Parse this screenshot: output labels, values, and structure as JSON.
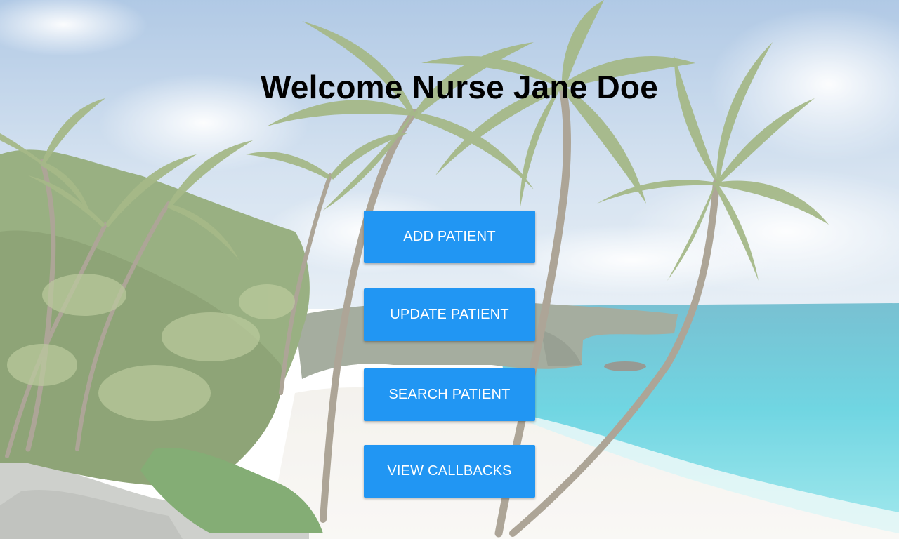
{
  "header": {
    "title": "Welcome Nurse Jane Doe"
  },
  "menu": {
    "buttons": [
      {
        "label": "ADD PATIENT"
      },
      {
        "label": "UPDATE PATIENT"
      },
      {
        "label": "SEARCH PATIENT"
      },
      {
        "label": "VIEW CALLBACKS"
      }
    ]
  },
  "theme": {
    "button_color": "#2196f3",
    "button_text_color": "#ffffff",
    "title_color": "#000000"
  },
  "background": {
    "scene": "tropical-beach-with-palm-trees"
  }
}
